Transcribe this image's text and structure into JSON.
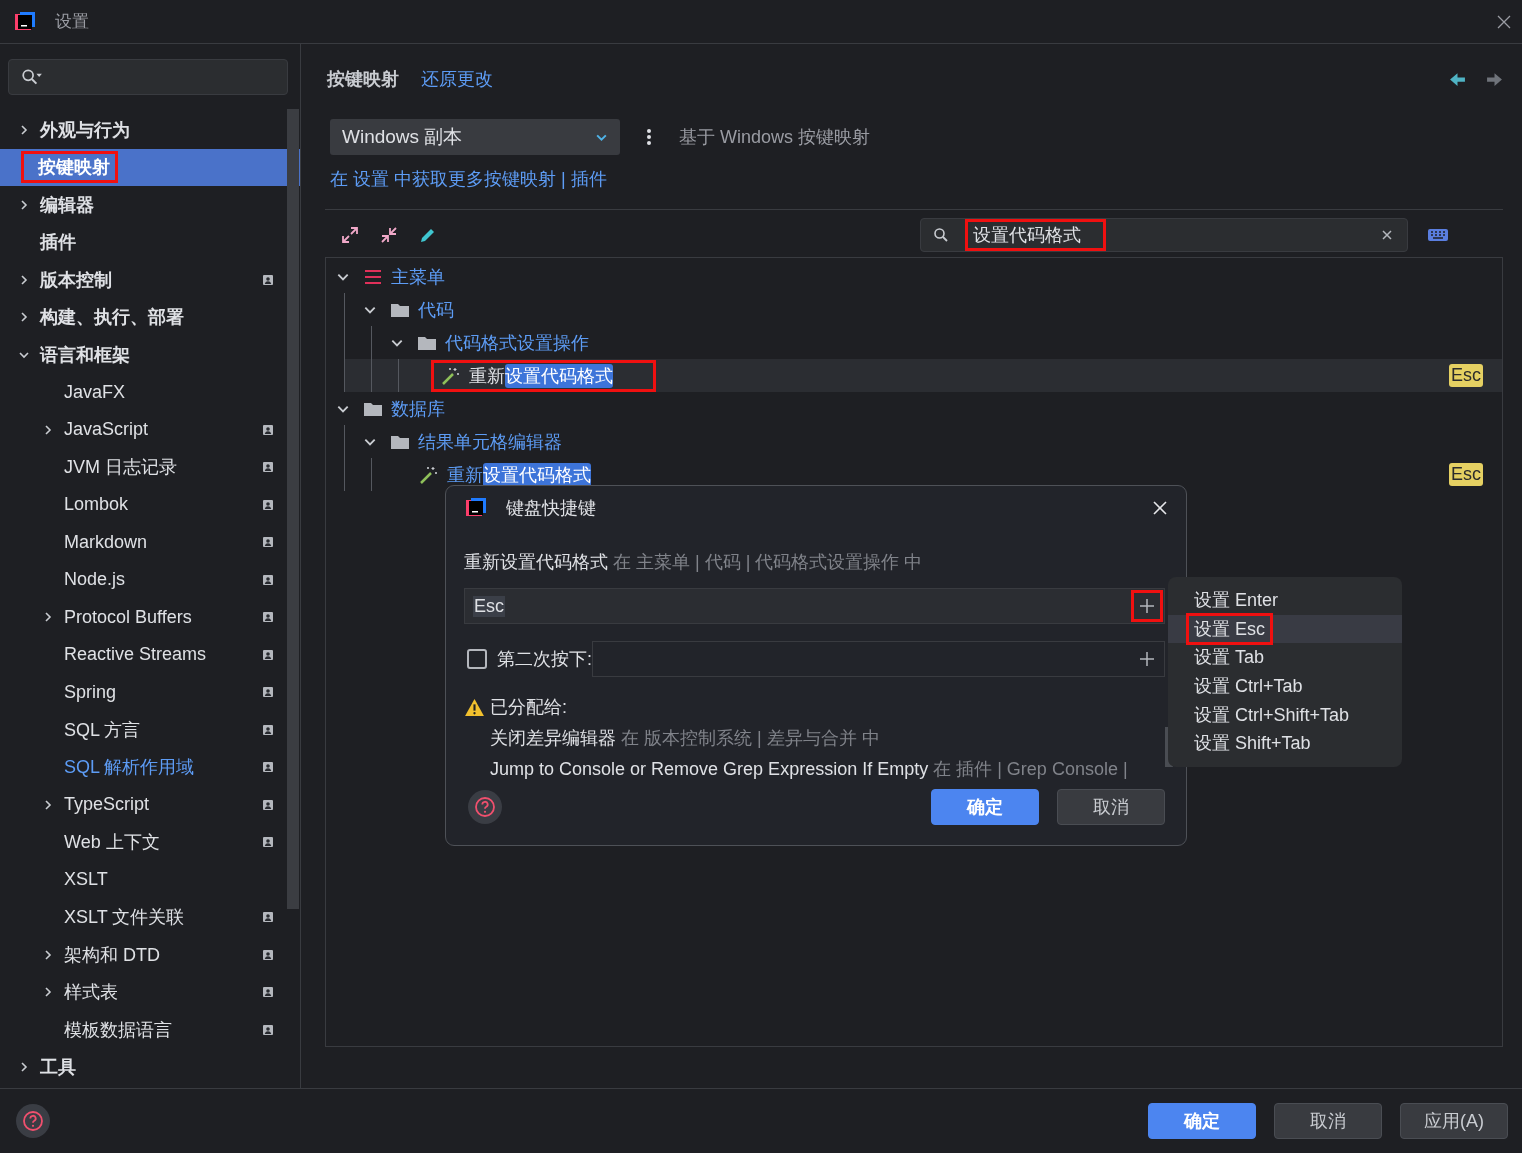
{
  "window": {
    "title": "设置"
  },
  "sidebar": {
    "items": [
      {
        "label": "外观与行为",
        "kind": "group",
        "expanded": false,
        "selected": false
      },
      {
        "label": "按键映射",
        "kind": "page",
        "selected": true,
        "marked": true
      },
      {
        "label": "编辑器",
        "kind": "group",
        "expanded": false,
        "selected": false
      },
      {
        "label": "插件",
        "kind": "page",
        "selected": false
      },
      {
        "label": "版本控制",
        "kind": "group",
        "expanded": false,
        "selected": false,
        "project": true
      },
      {
        "label": "构建、执行、部署",
        "kind": "group",
        "expanded": false,
        "selected": false
      },
      {
        "label": "语言和框架",
        "kind": "group",
        "expanded": true,
        "selected": false,
        "children": [
          {
            "label": "JavaFX",
            "kind": "page",
            "selected": false
          },
          {
            "label": "JavaScript",
            "kind": "group",
            "expanded": false,
            "selected": false,
            "project": true
          },
          {
            "label": "JVM 日志记录",
            "kind": "page",
            "selected": false,
            "project": true
          },
          {
            "label": "Lombok",
            "kind": "page",
            "selected": false,
            "project": true
          },
          {
            "label": "Markdown",
            "kind": "page",
            "selected": false,
            "project": true
          },
          {
            "label": "Node.js",
            "kind": "page",
            "selected": false,
            "project": true
          },
          {
            "label": "Protocol Buffers",
            "kind": "group",
            "expanded": false,
            "selected": false,
            "project": true
          },
          {
            "label": "Reactive Streams",
            "kind": "page",
            "selected": false,
            "project": true
          },
          {
            "label": "Spring",
            "kind": "page",
            "selected": false,
            "project": true
          },
          {
            "label": "SQL 方言",
            "kind": "page",
            "selected": false,
            "project": true
          },
          {
            "label": "SQL 解析作用域",
            "kind": "page",
            "selected": false,
            "project": true,
            "modified": true
          },
          {
            "label": "TypeScript",
            "kind": "group",
            "expanded": false,
            "selected": false,
            "project": true
          },
          {
            "label": "Web 上下文",
            "kind": "page",
            "selected": false,
            "project": true
          },
          {
            "label": "XSLT",
            "kind": "page",
            "selected": false
          },
          {
            "label": "XSLT 文件关联",
            "kind": "page",
            "selected": false,
            "project": true
          },
          {
            "label": "架构和 DTD",
            "kind": "group",
            "expanded": false,
            "selected": false,
            "project": true
          },
          {
            "label": "样式表",
            "kind": "group",
            "expanded": false,
            "selected": false,
            "project": true
          },
          {
            "label": "模板数据语言",
            "kind": "page",
            "selected": false,
            "project": true
          }
        ]
      },
      {
        "label": "工具",
        "kind": "group",
        "expanded": false,
        "selected": false
      }
    ]
  },
  "header": {
    "title": "按键映射",
    "reset_link": "还原更改"
  },
  "keymap": {
    "selected": "Windows 副本",
    "description": "基于 Windows 按键映射",
    "plugins_link": "在 设置 中获取更多按键映射 | 插件"
  },
  "filter": {
    "value": "设置代码格式",
    "marked": true
  },
  "tree": [
    {
      "kind": "menu",
      "label": "主菜单",
      "expanded": true,
      "children": [
        {
          "kind": "folder",
          "label": "代码",
          "expanded": true,
          "children": [
            {
              "kind": "folder",
              "label": "代码格式设置操作",
              "expanded": true,
              "children": [
                {
                  "kind": "action",
                  "prefix": "重新",
                  "match": "设置代码格式",
                  "shortcut": "Esc",
                  "selected": true,
                  "marked": true
                }
              ]
            }
          ]
        }
      ]
    },
    {
      "kind": "folder",
      "label": "数据库",
      "expanded": true,
      "children": [
        {
          "kind": "folder",
          "label": "结果单元格编辑器",
          "expanded": true,
          "children": [
            {
              "kind": "action",
              "prefix": "重新",
              "match": "设置代码格式",
              "shortcut": "Esc",
              "selected": false
            }
          ]
        }
      ]
    }
  ],
  "dialog": {
    "title": "键盘快捷键",
    "action": "重新设置代码格式",
    "action_path": "在 主菜单 | 代码 | 代码格式设置操作 中",
    "first_stroke": "Esc",
    "add_marked": true,
    "second_stroke": {
      "label": "第二次按下:",
      "checked": false
    },
    "conflict_heading": "已分配给:",
    "conflicts": [
      {
        "name": "关闭差异编辑器",
        "path": "在 版本控制系统 | 差异与合并 中"
      },
      {
        "name": "Jump to Console or Remove Grep Expression If Empty",
        "path": "在 插件 | Grep Console |"
      }
    ],
    "ok": "确定",
    "cancel": "取消"
  },
  "popup_menu": [
    {
      "label": "设置 Enter",
      "selected": false
    },
    {
      "label": "设置 Esc",
      "selected": true,
      "marked": true
    },
    {
      "label": "设置 Tab",
      "selected": false
    },
    {
      "label": "设置 Ctrl+Tab",
      "selected": false
    },
    {
      "label": "设置 Ctrl+Shift+Tab",
      "selected": false
    },
    {
      "label": "设置 Shift+Tab",
      "selected": false
    }
  ],
  "footer": {
    "ok": "确定",
    "cancel": "取消",
    "apply": "应用(A)"
  }
}
